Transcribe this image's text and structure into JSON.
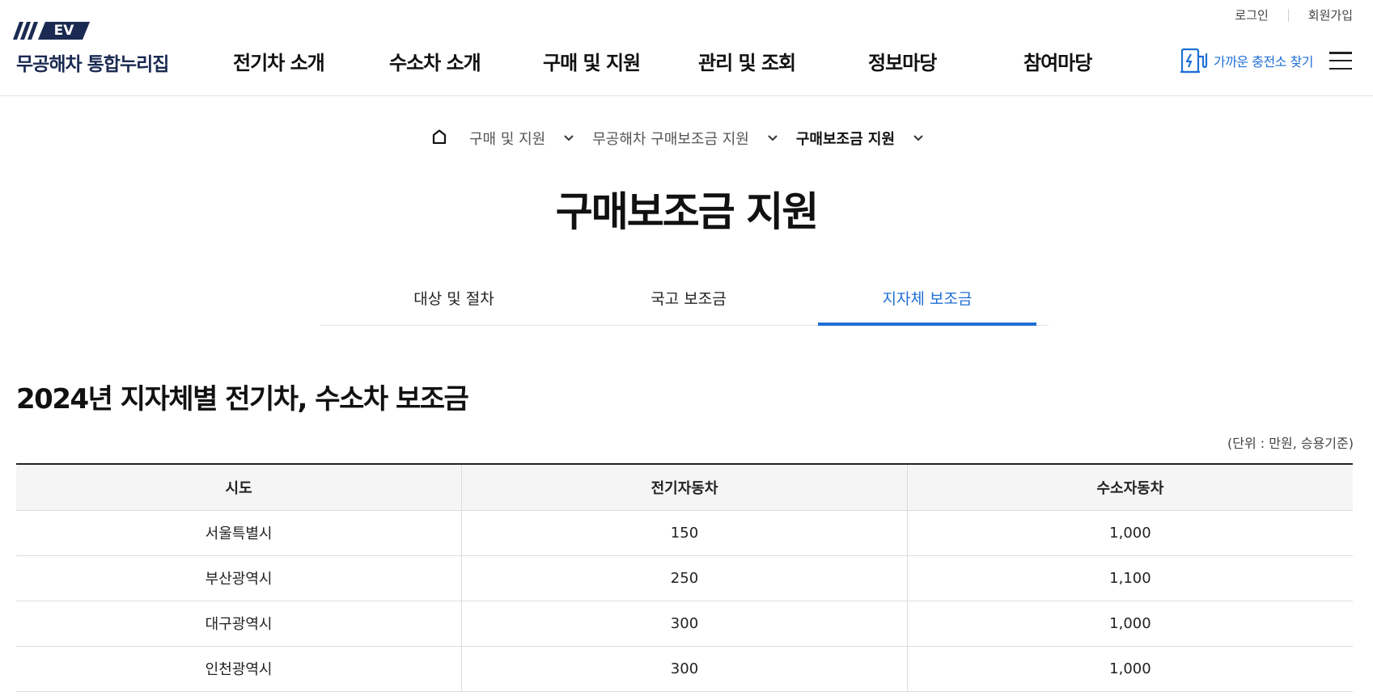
{
  "header": {
    "util": {
      "login": "로그인",
      "signup": "회원가입"
    },
    "logo": {
      "badge": "EV",
      "text": "무공해차 통합누리집"
    },
    "nav": [
      "전기차 소개",
      "수소차 소개",
      "구매 및 지원",
      "관리 및 조회",
      "정보마당",
      "참여마당"
    ],
    "charge_finder": "가까운 충전소 찾기"
  },
  "breadcrumb": {
    "items": [
      "구매 및 지원",
      "무공해차 구매보조금 지원",
      "구매보조금 지원"
    ]
  },
  "page_title": "구매보조금 지원",
  "tabs": [
    "대상 및 절차",
    "국고 보조금",
    "지자체 보조금"
  ],
  "active_tab": "지자체 보조금",
  "section_title": "2024년 지자체별 전기차, 수소차 보조금",
  "unit_note": "(단위 : 만원, 승용기준)",
  "table": {
    "headers": [
      "시도",
      "전기자동차",
      "수소자동차"
    ],
    "rows": [
      [
        "서울특별시",
        "150",
        "1,000"
      ],
      [
        "부산광역시",
        "250",
        "1,100"
      ],
      [
        "대구광역시",
        "300",
        "1,000"
      ],
      [
        "인천광역시",
        "300",
        "1,000"
      ]
    ]
  },
  "colors": {
    "brand": "#1a2a52",
    "accent": "#1f6fd6"
  }
}
